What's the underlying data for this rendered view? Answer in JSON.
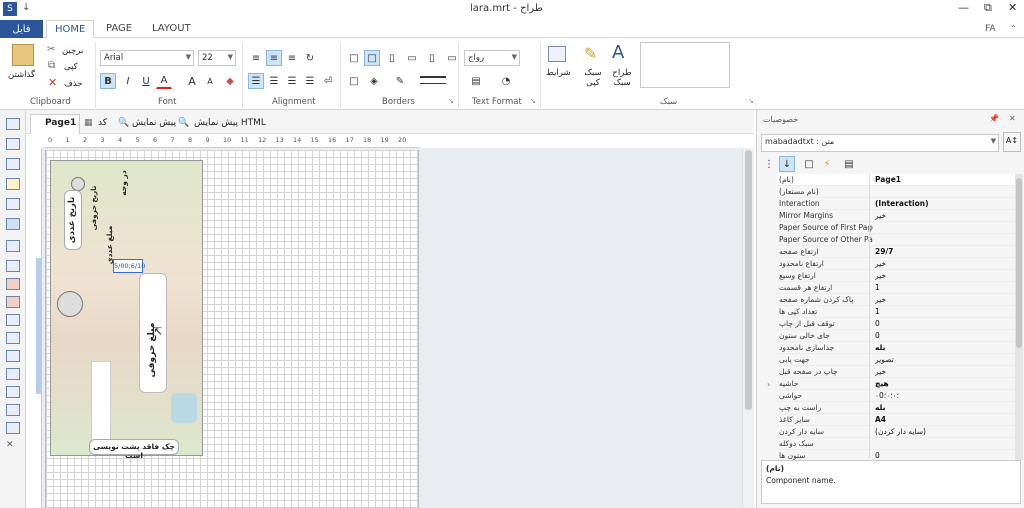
{
  "window": {
    "title": "lara.mrt - طراح",
    "quick_icon": "↓",
    "lang": "FA",
    "controls": {
      "minimize": "—",
      "restore": "⧉",
      "close": "✕"
    }
  },
  "tabs": {
    "file": "فایل",
    "home": "HOME",
    "page": "PAGE",
    "layout": "LAYOUT"
  },
  "clipboard": {
    "paste": "گذاشتن",
    "cut": "برچین",
    "copy": "کپی",
    "delete": "حذف",
    "label": "Clipboard"
  },
  "font": {
    "family": "Arial",
    "size": "22",
    "label": "Font",
    "bold": "B",
    "italic": "I",
    "underline": "U",
    "color": "A",
    "grow": "A",
    "shrink": "A"
  },
  "alignment": {
    "label": "Alignment"
  },
  "borders": {
    "label": "Borders"
  },
  "text_format": {
    "value": "رواج",
    "label": "Text Format"
  },
  "style": {
    "conditions": "شرایط",
    "copy_style": "سبک کپی",
    "design_style": "طراح سبک",
    "label": "سبک"
  },
  "doc": {
    "page_tab": "Page1",
    "code_tab": "کد",
    "preview_tab": "پیش نمایش",
    "html_preview_tab": "پیش نمایش HTML"
  },
  "ruler": [
    "0",
    "1",
    "2",
    "3",
    "4",
    "5",
    "6",
    "7",
    "8",
    "9",
    "10",
    "11",
    "12",
    "13",
    "14",
    "15",
    "16",
    "17",
    "18",
    "19",
    "20"
  ],
  "cheque": {
    "date_field": "تاریخ عددی",
    "date_value": "5/00;6/10",
    "date_letters": "تاریخ حروفی",
    "amount_field": "مبلغ عددی",
    "name_field": "در وجه",
    "amount_words": "مبلغ حروفی",
    "footer": "چک فاقد پشت نویسی است"
  },
  "properties": {
    "title": "خصوصیات",
    "pin": "📌",
    "close": "✕",
    "selector": "mabadadtxt : متن",
    "rows": [
      [
        "(نام)",
        "Page1"
      ],
      [
        "(نام مستعار)",
        ""
      ],
      [
        "Interaction",
        "(Interaction)"
      ],
      [
        "Mirror Margins",
        "خیر"
      ],
      [
        "Paper Source of First Page",
        ""
      ],
      [
        "Paper Source of Other Pages",
        ""
      ],
      [
        "ارتفاع صفحه",
        "29/7"
      ],
      [
        "ارتفاع نامحدود",
        "خیر"
      ],
      [
        "ارتفاع وسیع",
        "خیر"
      ],
      [
        "ارتفاع هر قسمت",
        "1"
      ],
      [
        "پاک کردن شماره صفحه",
        "خیر"
      ],
      [
        "تعداد کپی ها",
        "1"
      ],
      [
        "توقف قبل از چاپ",
        "0"
      ],
      [
        "جای خالی ستون",
        "0"
      ],
      [
        "جداسازی نامحدود",
        "بله"
      ],
      [
        "جهت یابی",
        "تصویر"
      ],
      [
        "چاپ در صفحه قبل",
        "خیر"
      ],
      [
        "حاشیه",
        "هیچ"
      ],
      [
        "حواشی",
        "۰؛۰؛۰؛0"
      ],
      [
        "راست به چپ",
        "بله"
      ],
      [
        "سایز کاغذ",
        "A4"
      ],
      [
        "سایه دار کردن",
        "(سایه دار کردن)"
      ],
      [
        "سبک دوکله",
        ""
      ],
      [
        "ستون ها",
        "0"
      ]
    ],
    "desc_title": "(نام)",
    "desc_text": "Component name."
  }
}
